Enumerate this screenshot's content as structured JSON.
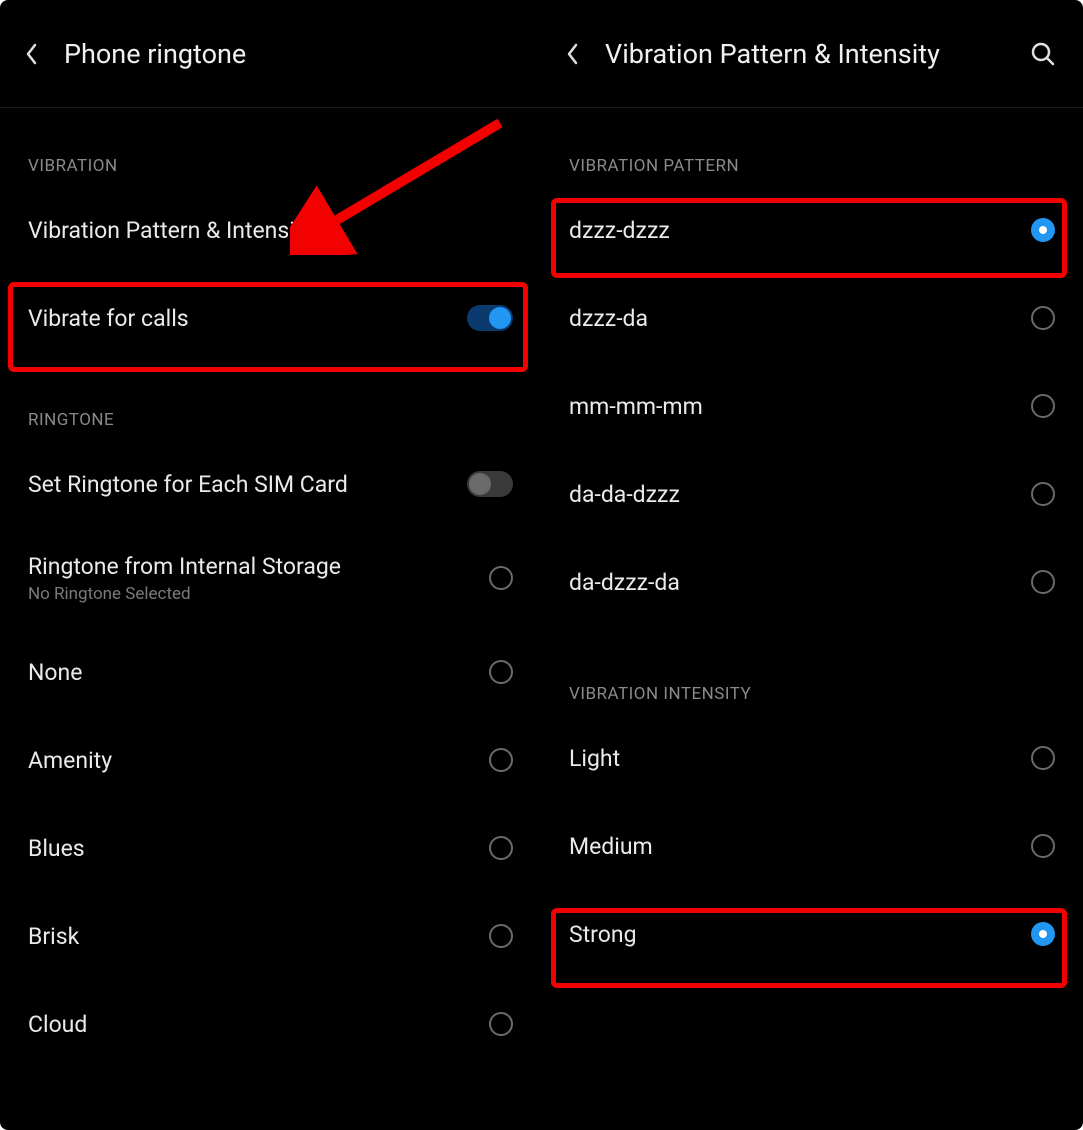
{
  "left": {
    "header": {
      "title": "Phone ringtone"
    },
    "sections": {
      "vibration": {
        "label": "VIBRATION",
        "pattern_row": "Vibration Pattern & Intensity",
        "vibrate_calls": {
          "label": "Vibrate for calls",
          "on": true
        }
      },
      "ringtone": {
        "label": "RINGTONE",
        "set_per_sim": {
          "label": "Set Ringtone for Each SIM Card",
          "on": false
        },
        "from_storage": {
          "label": "Ringtone from Internal Storage",
          "sub": "No Ringtone Selected"
        },
        "options": [
          "None",
          "Amenity",
          "Blues",
          "Brisk",
          "Cloud"
        ]
      }
    }
  },
  "right": {
    "header": {
      "title": "Vibration Pattern & Intensity"
    },
    "sections": {
      "pattern": {
        "label": "VIBRATION PATTERN",
        "options": [
          {
            "label": "dzzz-dzzz",
            "selected": true
          },
          {
            "label": "dzzz-da",
            "selected": false
          },
          {
            "label": "mm-mm-mm",
            "selected": false
          },
          {
            "label": "da-da-dzzz",
            "selected": false
          },
          {
            "label": "da-dzzz-da",
            "selected": false
          }
        ]
      },
      "intensity": {
        "label": "VIBRATION INTENSITY",
        "options": [
          {
            "label": "Light",
            "selected": false
          },
          {
            "label": "Medium",
            "selected": false
          },
          {
            "label": "Strong",
            "selected": true
          }
        ]
      }
    }
  }
}
